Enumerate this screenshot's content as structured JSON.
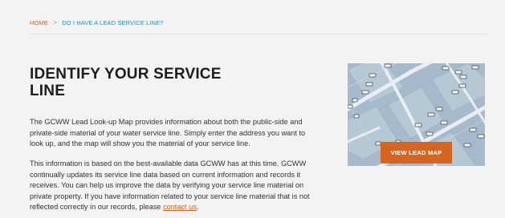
{
  "breadcrumb": {
    "home": "HOME",
    "separator": ">",
    "current": "DO I HAVE A LEAD SERVICE LINE?"
  },
  "page_title": "IDENTIFY YOUR SERVICE LINE",
  "intro": "The GCWW Lead Look-up Map provides information about both the public-side and private-side material of your water service line. Simply enter the address you want to look up, and the map will show you the material of your service line.",
  "info": {
    "text": "This information is based on the best-available data GCWW has at this time. GCWW continually updates its service line data based on current information and records it receives. You can help us improve the data by verifying your service line material on private property. If you have information related to your service line material that is not reflected correctly in our records, please ",
    "link": "contact us",
    "end": "."
  },
  "map_card": {
    "button_label": "VIEW LEAD MAP",
    "icon": "map-thumbnail-image"
  },
  "colors": {
    "accent": "#d8651f",
    "link_blue": "#1f8fb8",
    "background": "#f3f3f4"
  }
}
